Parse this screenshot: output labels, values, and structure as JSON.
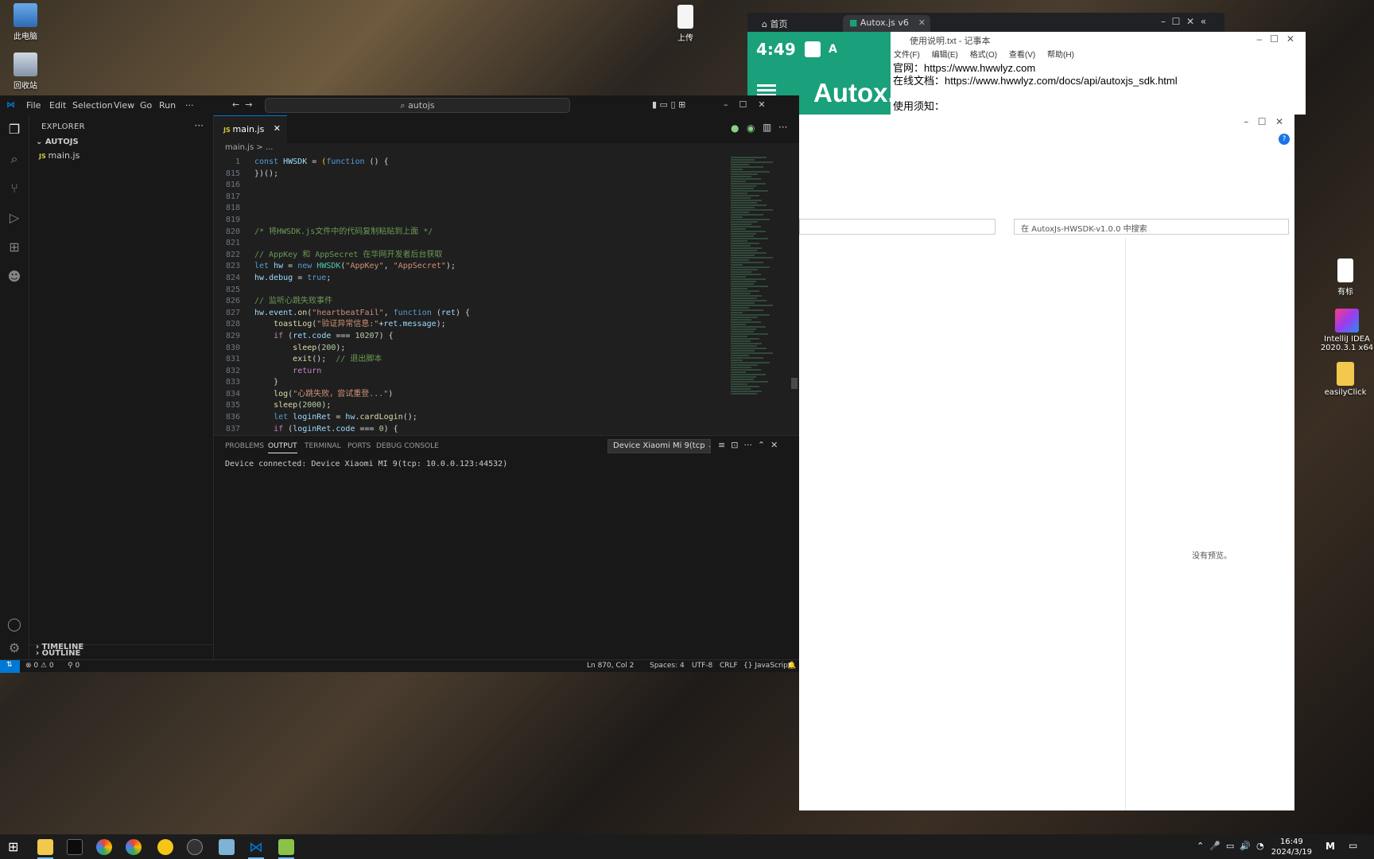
{
  "desktop": {
    "icons_left": [
      {
        "label": "此电脑"
      },
      {
        "label": "回收站"
      }
    ],
    "icon_top": {
      "label": "上传"
    },
    "icons_right": [
      {
        "label": "有标"
      },
      {
        "label": "IntelliJ IDEA 2020.3.1 x64"
      },
      {
        "label": "easilyClick"
      }
    ]
  },
  "browser": {
    "tabs": [
      {
        "label": "首页"
      },
      {
        "label": "Autox.js v6"
      }
    ]
  },
  "autox": {
    "time": "4:49",
    "title": "Autox.j"
  },
  "notepad": {
    "title": "使用说明.txt - 记事本",
    "menu": [
      "文件(F)",
      "编辑(E)",
      "格式(O)",
      "查看(V)",
      "帮助(H)"
    ],
    "lines": [
      {
        "label": "官网：",
        "value": "https://www.hwwlyz.com"
      },
      {
        "label": "在线文档：",
        "value": "https://www.hwwlyz.com/docs/api/autoxjs_sdk.html"
      },
      {
        "label": "",
        "value": ""
      },
      {
        "label": "使用须知：",
        "value": ""
      }
    ]
  },
  "explorer_window": {
    "search_placeholder": "在 AutoxJs-HWSDK-v1.0.0 中搜索",
    "no_preview": "没有预览。"
  },
  "vscode": {
    "menu": [
      "File",
      "Edit",
      "Selection",
      "View",
      "Go",
      "Run",
      "···"
    ],
    "command_center": "autojs",
    "explorer_title": "EXPLORER",
    "folder": "AUTOJS",
    "file": "main.js",
    "outline": "OUTLINE",
    "timeline": "TIMELINE",
    "tab": "main.js",
    "breadcrumb": "main.js > ...",
    "panel_tabs": [
      "PROBLEMS",
      "OUTPUT",
      "TERMINAL",
      "PORTS",
      "DEBUG CONSOLE"
    ],
    "device_select": "Device Xiaomi Mi 9(tcp",
    "output": "Device connected: Device Xiaomi MI 9(tcp: 10.0.0.123:44532)",
    "status": {
      "errors": "⊗ 0 ⚠ 0",
      "ports": "⚲ 0",
      "position": "Ln 870, Col 2",
      "spaces": "Spaces: 4",
      "encoding": "UTF-8",
      "eol": "CRLF",
      "language": "{} JavaScript"
    },
    "code_lines": [
      {
        "n": "1",
        "tokens": [
          [
            "k",
            "const "
          ],
          [
            "v",
            "HWSDK"
          ],
          [
            "t",
            " = "
          ],
          [
            "y",
            "("
          ],
          [
            "k",
            "function"
          ],
          [
            "t",
            " () {"
          ]
        ]
      },
      {
        "n": "815",
        "tokens": [
          [
            "t",
            "})();"
          ]
        ]
      },
      {
        "n": "816",
        "tokens": []
      },
      {
        "n": "817",
        "tokens": []
      },
      {
        "n": "818",
        "tokens": []
      },
      {
        "n": "819",
        "tokens": []
      },
      {
        "n": "820",
        "tokens": [
          [
            "c",
            "/* 将HWSDK.js文件中的代码复制粘贴到上面 */"
          ]
        ]
      },
      {
        "n": "821",
        "tokens": []
      },
      {
        "n": "822",
        "tokens": [
          [
            "c",
            "// AppKey 和 AppSecret 在华网开发者后台获取"
          ]
        ]
      },
      {
        "n": "823",
        "tokens": [
          [
            "k",
            "let "
          ],
          [
            "v",
            "hw"
          ],
          [
            "t",
            " = "
          ],
          [
            "k",
            "new "
          ],
          [
            "cl",
            "HWSDK"
          ],
          [
            "t",
            "("
          ],
          [
            "s",
            "\"AppKey\""
          ],
          [
            "t",
            ", "
          ],
          [
            "s",
            "\"AppSecret\""
          ],
          [
            "t",
            ");"
          ]
        ]
      },
      {
        "n": "824",
        "tokens": [
          [
            "v",
            "hw"
          ],
          [
            "t",
            "."
          ],
          [
            "v",
            "debug"
          ],
          [
            "t",
            " = "
          ],
          [
            "k",
            "true"
          ],
          [
            "t",
            ";"
          ]
        ]
      },
      {
        "n": "825",
        "tokens": []
      },
      {
        "n": "826",
        "tokens": [
          [
            "c",
            "// 监听心跳失败事件"
          ]
        ]
      },
      {
        "n": "827",
        "tokens": [
          [
            "v",
            "hw"
          ],
          [
            "t",
            "."
          ],
          [
            "v",
            "event"
          ],
          [
            "t",
            "."
          ],
          [
            "f",
            "on"
          ],
          [
            "t",
            "("
          ],
          [
            "s",
            "\"heartbeatFail\""
          ],
          [
            "t",
            ", "
          ],
          [
            "k",
            "function"
          ],
          [
            "t",
            " ("
          ],
          [
            "v",
            "ret"
          ],
          [
            "t",
            ") {"
          ]
        ]
      },
      {
        "n": "828",
        "tokens": [
          [
            "t",
            "    "
          ],
          [
            "f",
            "toastLog"
          ],
          [
            "t",
            "("
          ],
          [
            "s",
            "\"验证异常信息:\""
          ],
          [
            "t",
            "+"
          ],
          [
            "v",
            "ret"
          ],
          [
            "t",
            "."
          ],
          [
            "v",
            "message"
          ],
          [
            "t",
            ");"
          ]
        ]
      },
      {
        "n": "829",
        "tokens": [
          [
            "t",
            "    "
          ],
          [
            "p",
            "if"
          ],
          [
            "t",
            " ("
          ],
          [
            "v",
            "ret"
          ],
          [
            "t",
            "."
          ],
          [
            "v",
            "code"
          ],
          [
            "t",
            " === "
          ],
          [
            "n",
            "10207"
          ],
          [
            "t",
            ") {"
          ]
        ]
      },
      {
        "n": "830",
        "tokens": [
          [
            "t",
            "        "
          ],
          [
            "f",
            "sleep"
          ],
          [
            "t",
            "("
          ],
          [
            "n",
            "200"
          ],
          [
            "t",
            ");"
          ]
        ]
      },
      {
        "n": "831",
        "tokens": [
          [
            "t",
            "        "
          ],
          [
            "f",
            "exit"
          ],
          [
            "t",
            "();  "
          ],
          [
            "c",
            "// 退出脚本"
          ]
        ]
      },
      {
        "n": "832",
        "tokens": [
          [
            "t",
            "        "
          ],
          [
            "p",
            "return"
          ]
        ]
      },
      {
        "n": "833",
        "tokens": [
          [
            "t",
            "    }"
          ]
        ]
      },
      {
        "n": "834",
        "tokens": [
          [
            "t",
            "    "
          ],
          [
            "f",
            "log"
          ],
          [
            "t",
            "("
          ],
          [
            "s",
            "\"心跳失败，尝试重登...\""
          ],
          [
            "t",
            ")"
          ]
        ]
      },
      {
        "n": "835",
        "tokens": [
          [
            "t",
            "    "
          ],
          [
            "f",
            "sleep"
          ],
          [
            "t",
            "("
          ],
          [
            "n",
            "2000"
          ],
          [
            "t",
            ");"
          ]
        ]
      },
      {
        "n": "836",
        "tokens": [
          [
            "t",
            "    "
          ],
          [
            "k",
            "let "
          ],
          [
            "v",
            "loginRet"
          ],
          [
            "t",
            " = "
          ],
          [
            "v",
            "hw"
          ],
          [
            "t",
            "."
          ],
          [
            "f",
            "cardLogin"
          ],
          [
            "t",
            "();"
          ]
        ]
      },
      {
        "n": "837",
        "tokens": [
          [
            "t",
            "    "
          ],
          [
            "p",
            "if"
          ],
          [
            "t",
            " ("
          ],
          [
            "v",
            "loginRet"
          ],
          [
            "t",
            "."
          ],
          [
            "v",
            "code"
          ],
          [
            "t",
            " === "
          ],
          [
            "n",
            "0"
          ],
          [
            "t",
            ") {"
          ]
        ]
      }
    ]
  },
  "taskbar": {
    "time": "16:49",
    "date": "2024/3/19",
    "ime": "M"
  },
  "colors": {
    "accent": "#0078d4",
    "autox_green": "#1aa07a"
  }
}
